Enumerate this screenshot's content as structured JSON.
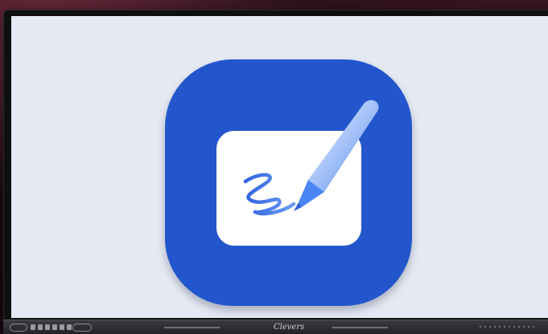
{
  "app": {
    "icon_name": "whiteboard-pen-icon",
    "accent_color": "#2356cc",
    "canvas_color": "#ffffff"
  },
  "device": {
    "brand_text": "Clevers",
    "front_ports_icon": "front-ports-icon",
    "button_icon": "power-button-icon"
  },
  "colors": {
    "screen_background": "#e4e9f3",
    "pen_light": "#d9e6ff",
    "pen_dark": "#3f7bf0",
    "scribble": "#3b6fe6"
  }
}
